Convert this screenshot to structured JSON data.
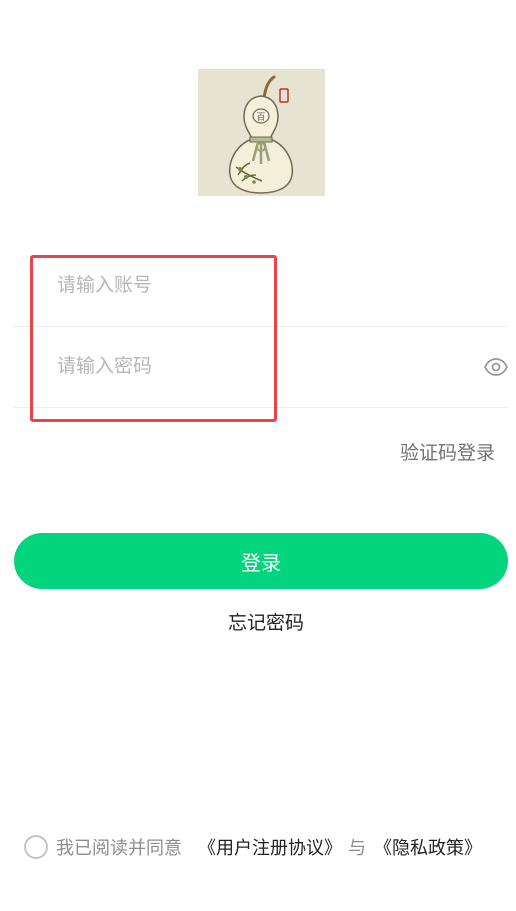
{
  "logo": {
    "icon": "gourd-icon",
    "seal_text": "百"
  },
  "account": {
    "placeholder": "请输入账号",
    "value": ""
  },
  "password": {
    "placeholder": "请输入密码",
    "value": "",
    "toggle_icon": "eye-icon"
  },
  "sms_login_label": "验证码登录",
  "login_button_label": "登录",
  "forgot_password_label": "忘记密码",
  "agreement": {
    "prefix": "我已阅读并同意",
    "user_agreement": "《用户注册协议》",
    "conjunction": "与",
    "privacy_policy": "《隐私政策》"
  },
  "colors": {
    "primary": "#02d57d",
    "highlight": "#e8454a",
    "placeholder": "#b6b6b6",
    "logo_bg": "#e7e3d1"
  }
}
